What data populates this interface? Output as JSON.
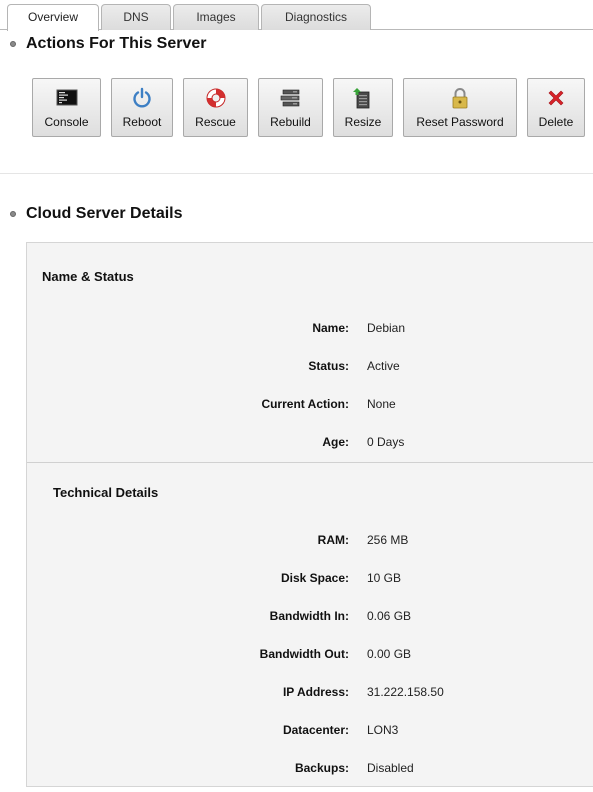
{
  "tabs": [
    {
      "label": "Overview",
      "active": true
    },
    {
      "label": "DNS",
      "active": false
    },
    {
      "label": "Images",
      "active": false
    },
    {
      "label": "Diagnostics",
      "active": false
    }
  ],
  "actions": {
    "title": "Actions For This Server",
    "buttons": [
      {
        "label": "Console",
        "icon": "console-icon"
      },
      {
        "label": "Reboot",
        "icon": "power-icon"
      },
      {
        "label": "Rescue",
        "icon": "lifebuoy-icon"
      },
      {
        "label": "Rebuild",
        "icon": "server-stack-icon"
      },
      {
        "label": "Resize",
        "icon": "resize-server-icon"
      },
      {
        "label": "Reset Password",
        "icon": "padlock-icon"
      },
      {
        "label": "Delete",
        "icon": "red-x-icon"
      }
    ]
  },
  "details": {
    "title": "Cloud Server Details",
    "name_status": {
      "heading": "Name & Status",
      "rows": [
        {
          "label": "Name:",
          "value": "Debian"
        },
        {
          "label": "Status:",
          "value": "Active"
        },
        {
          "label": "Current Action:",
          "value": "None"
        },
        {
          "label": "Age:",
          "value": "0 Days"
        }
      ]
    },
    "technical": {
      "heading": "Technical Details",
      "rows": [
        {
          "label": "RAM:",
          "value": "256 MB"
        },
        {
          "label": "Disk Space:",
          "value": "10 GB"
        },
        {
          "label": "Bandwidth In:",
          "value": "0.06 GB"
        },
        {
          "label": "Bandwidth Out:",
          "value": "0.00 GB"
        },
        {
          "label": "IP Address:",
          "value": "31.222.158.50"
        },
        {
          "label": "Datacenter:",
          "value": "LON3"
        },
        {
          "label": "Backups:",
          "value": "Disabled"
        }
      ]
    }
  },
  "colors": {
    "delete_red": "#d8232a",
    "reboot_blue": "#3d7fc4",
    "resize_green": "#3aa33a"
  }
}
